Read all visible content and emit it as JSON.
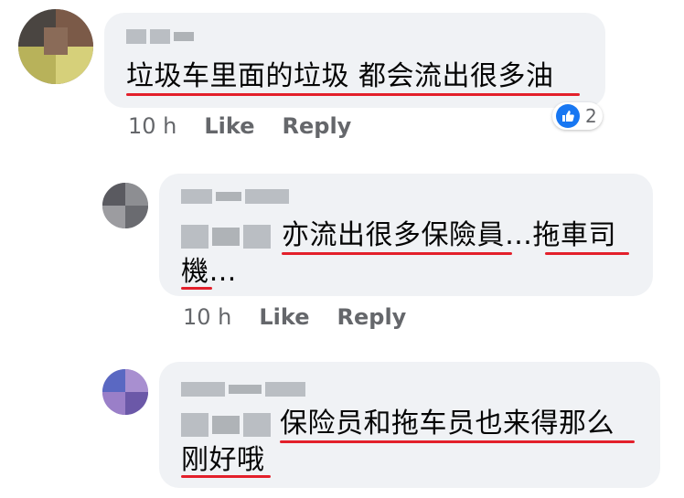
{
  "comments": [
    {
      "text": "垃圾车里面的垃圾 都会流出很多油",
      "time": "10 h",
      "like_label": "Like",
      "reply_label": "Reply",
      "reaction_count": "2"
    },
    {
      "text_line1": "亦流出很多保險員…拖車司",
      "text_line2": "機…",
      "time": "10 h",
      "like_label": "Like",
      "reply_label": "Reply"
    },
    {
      "text_line1": "保险员和拖车员也来得那么",
      "text_line2": "刚好哦"
    }
  ],
  "colors": {
    "bubble": "#f0f2f5",
    "underline": "#e3202b",
    "like_blue": "#1877f2",
    "meta_gray": "#65676b"
  },
  "icons": [
    "thumbs-up-icon"
  ]
}
